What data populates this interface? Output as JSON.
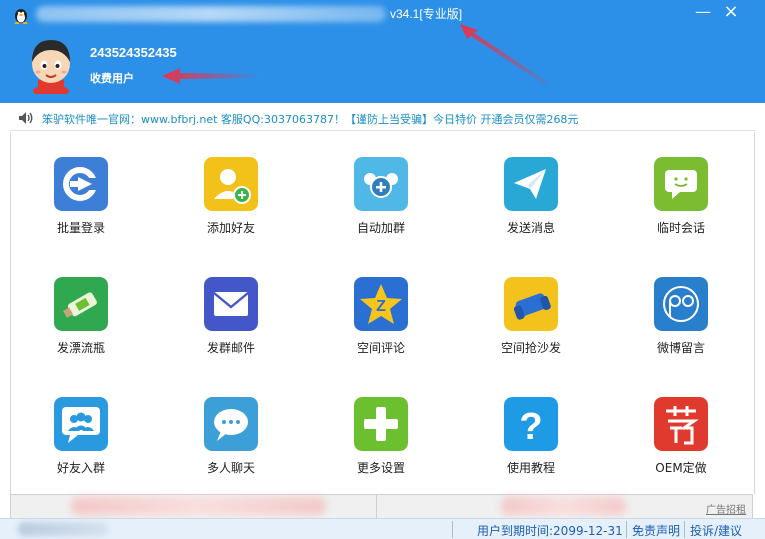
{
  "title_bar": {
    "version": "v34.1[专业版]",
    "minimize_symbol": "—",
    "close_symbol": "×"
  },
  "user": {
    "id": "243524352435",
    "type": "收费用户"
  },
  "notice": {
    "text": "笨驴软件唯一官网：www.bfbrj.net 客服QQ:3037063787！【谨防上当受骗】今日特价 开通会员仅需268元"
  },
  "features": [
    {
      "label": "批量登录",
      "icon": "login-arrow-icon",
      "color": "#3d7fd6"
    },
    {
      "label": "添加好友",
      "icon": "add-friend-icon",
      "color": "#f2c21b"
    },
    {
      "label": "自动加群",
      "icon": "auto-join-group-icon",
      "color": "#4fb8e6"
    },
    {
      "label": "发送消息",
      "icon": "paper-plane-icon",
      "color": "#29a8d6"
    },
    {
      "label": "临时会话",
      "icon": "chat-smile-icon",
      "color": "#7cbc30"
    },
    {
      "label": "发漂流瓶",
      "icon": "drift-bottle-icon",
      "color": "#2fa84f"
    },
    {
      "label": "发群邮件",
      "icon": "envelope-icon",
      "color": "#4457c8"
    },
    {
      "label": "空间评论",
      "icon": "qzone-star-icon",
      "color": "#2a6fd1"
    },
    {
      "label": "空间抢沙发",
      "icon": "sofa-icon",
      "color": "#f4c21c"
    },
    {
      "label": "微博留言",
      "icon": "weibo-icon",
      "color": "#2a7fcc"
    },
    {
      "label": "好友入群",
      "icon": "friends-group-icon",
      "color": "#2a9ae0"
    },
    {
      "label": "多人聊天",
      "icon": "chat-bubble-icon",
      "color": "#3d9fd8"
    },
    {
      "label": "更多设置",
      "icon": "plus-icon",
      "color": "#6cbf2e"
    },
    {
      "label": "使用教程",
      "icon": "question-icon",
      "color": "#1f9be6"
    },
    {
      "label": "OEM定做",
      "icon": "recommend-icon",
      "color": "#e03a2f"
    }
  ],
  "footer": {
    "ad_link": "广告招租"
  },
  "status_bar": {
    "expiry": "用户到期时间:2099-12-31",
    "disclaimer": "免责声明",
    "feedback": "投诉/建议"
  }
}
